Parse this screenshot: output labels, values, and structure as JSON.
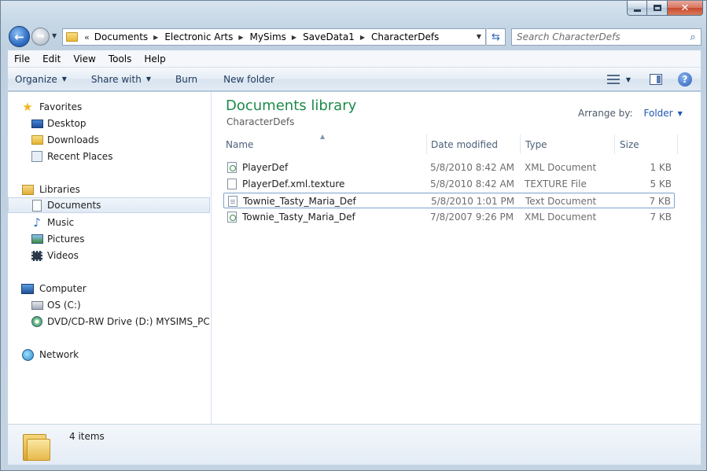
{
  "address": {
    "crumbs": [
      "Documents",
      "Electronic Arts",
      "MySims",
      "SaveData1",
      "CharacterDefs"
    ]
  },
  "search": {
    "placeholder": "Search CharacterDefs"
  },
  "menu": [
    "File",
    "Edit",
    "View",
    "Tools",
    "Help"
  ],
  "commands": {
    "organize": "Organize",
    "share_with": "Share with",
    "burn": "Burn",
    "new_folder": "New folder"
  },
  "nav": {
    "favorites": "Favorites",
    "desktop": "Desktop",
    "downloads": "Downloads",
    "recent_places": "Recent Places",
    "libraries": "Libraries",
    "documents": "Documents",
    "music": "Music",
    "pictures": "Pictures",
    "videos": "Videos",
    "computer": "Computer",
    "os_drive": "OS (C:)",
    "dvd_drive": "DVD/CD-RW Drive (D:) MYSIMS_PC",
    "network": "Network"
  },
  "library": {
    "title": "Documents library",
    "subtitle": "CharacterDefs",
    "arrange_label": "Arrange by:",
    "arrange_value": "Folder"
  },
  "columns": [
    "Name",
    "Date modified",
    "Type",
    "Size"
  ],
  "files": [
    {
      "name": "PlayerDef",
      "date": "5/8/2010 8:42 AM",
      "type": "XML Document",
      "size": "1 KB",
      "icon": "xml-file-icon"
    },
    {
      "name": "PlayerDef.xml.texture",
      "date": "5/8/2010 8:42 AM",
      "type": "TEXTURE File",
      "size": "5 KB",
      "icon": "texture-file-icon"
    },
    {
      "name": "Townie_Tasty_Maria_Def",
      "date": "5/8/2010 1:01 PM",
      "type": "Text Document",
      "size": "7 KB",
      "icon": "text-file-icon"
    },
    {
      "name": "Townie_Tasty_Maria_Def",
      "date": "7/8/2007 9:26 PM",
      "type": "XML Document",
      "size": "7 KB",
      "icon": "xml-file-icon"
    }
  ],
  "details": {
    "count": "4 items"
  },
  "colors": {
    "library_title": "#1e8a4a",
    "link_blue": "#1f56b1"
  }
}
